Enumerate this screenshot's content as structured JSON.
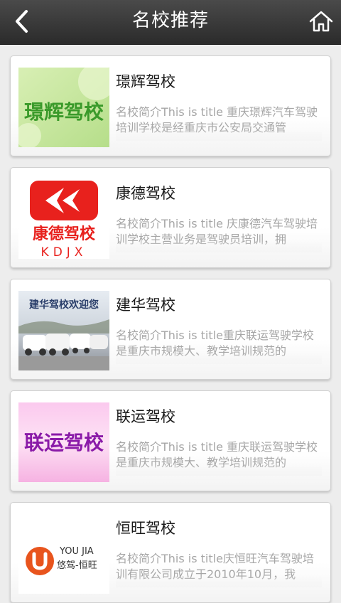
{
  "header": {
    "title": "名校推荐",
    "back_icon": "chevron-left-icon",
    "home_icon": "home-icon"
  },
  "schools": [
    {
      "name": "璟辉驾校",
      "desc": "名校简介This is title 重庆璟辉汽车驾驶培训学校是经重庆市公安局交通管",
      "logo": {
        "text": "璟辉驾校",
        "bg": "#cfe8a8",
        "color": "#3a9a2a"
      }
    },
    {
      "name": "康德驾校",
      "desc": "名校简介This is title 庆康德汽车驾驶培训学校主营业务是驾驶员培训，拥",
      "logo": {
        "text": "康德驾校",
        "sub": "KDJX",
        "color": "#e8211d"
      }
    },
    {
      "name": "建华驾校",
      "desc": "名校简介This is title重庆联运驾驶学校是重庆市规模大、教学培训规范的",
      "logo": {
        "text": "建华驾校欢迎您"
      }
    },
    {
      "name": "联运驾校",
      "desc": "名校简介This is title 重庆联运驾驶学校是重庆市规模大、教学培训规范的",
      "logo": {
        "text": "联运驾校",
        "color": "#8a1aa8"
      }
    },
    {
      "name": "恒旺驾校",
      "desc": "名校简介This is title庆恒旺汽车驾驶培训有限公司成立于2010年10月，我",
      "logo": {
        "text": "YOU JIA",
        "sub": "悠驾-恒旺",
        "color": "#e8541d"
      }
    }
  ]
}
